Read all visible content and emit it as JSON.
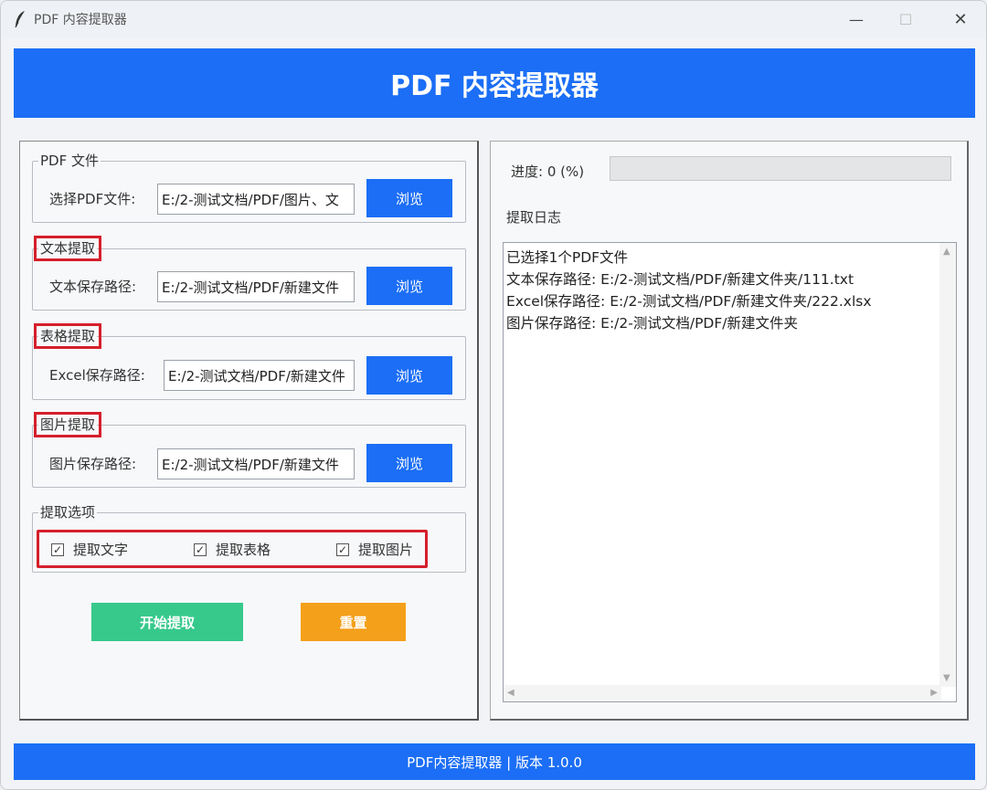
{
  "window": {
    "title": "PDF 内容提取器",
    "app_icon": "feather-icon",
    "controls": {
      "minimize": "—",
      "maximize": "☐",
      "close": "✕"
    }
  },
  "header": {
    "title": "PDF 内容提取器"
  },
  "pdf_group": {
    "legend": "PDF 文件",
    "label": "选择PDF文件:",
    "value": "E:/2-测试文档/PDF/图片、文",
    "browse": "浏览"
  },
  "text_group": {
    "legend": "文本提取",
    "label": "文本保存路径:",
    "value": "E:/2-测试文档/PDF/新建文件",
    "browse": "浏览"
  },
  "table_group": {
    "legend": "表格提取",
    "label": "Excel保存路径:",
    "value": "E:/2-测试文档/PDF/新建文件",
    "browse": "浏览"
  },
  "image_group": {
    "legend": "图片提取",
    "label": "图片保存路径:",
    "value": "E:/2-测试文档/PDF/新建文件",
    "browse": "浏览"
  },
  "options": {
    "legend": "提取选项",
    "items": [
      {
        "label": "提取文字",
        "checked": true
      },
      {
        "label": "提取表格",
        "checked": true
      },
      {
        "label": "提取图片",
        "checked": true
      }
    ],
    "checkmark": "☑"
  },
  "actions": {
    "start": "开始提取",
    "reset": "重置"
  },
  "progress": {
    "label": "进度: 0 (%)",
    "percent": 0
  },
  "log": {
    "title": "提取日志",
    "lines": [
      "已选择1个PDF文件",
      "文本保存路径: E:/2-测试文档/PDF/新建文件夹/111.txt",
      "Excel保存路径: E:/2-测试文档/PDF/新建文件夹/222.xlsx",
      "图片保存路径: E:/2-测试文档/PDF/新建文件夹"
    ],
    "scroll_up": "▲",
    "scroll_down": "▼",
    "scroll_left": "◀",
    "scroll_right": "▶"
  },
  "footer": {
    "text": "PDF内容提取器 | 版本 1.0.0"
  },
  "colors": {
    "accent": "#1b6ef5",
    "start": "#37c98c",
    "reset": "#f4a01a",
    "highlight": "#d51f2b"
  }
}
